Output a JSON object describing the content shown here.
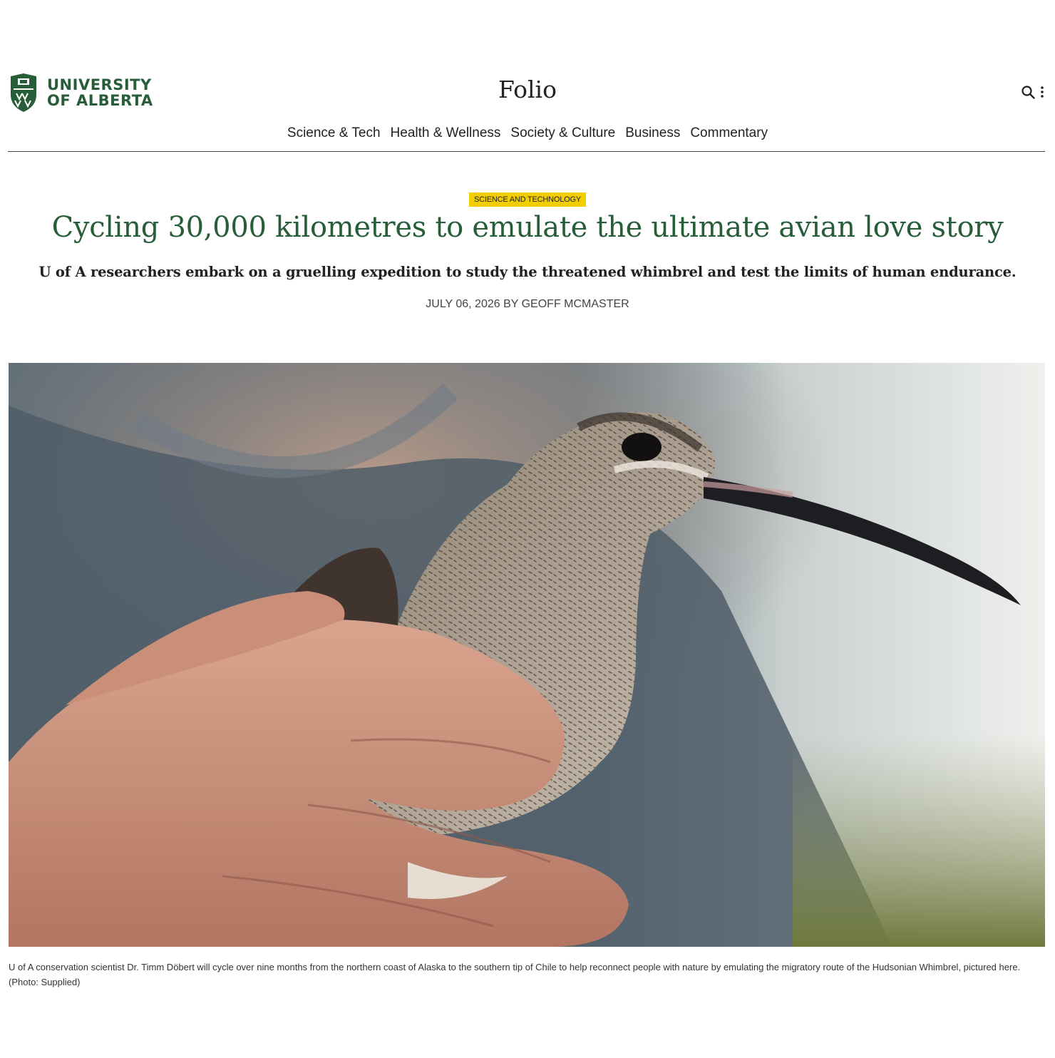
{
  "header": {
    "logo": {
      "line1": "UNIVERSITY",
      "line2": "OF ALBERTA"
    },
    "site_title": "Folio",
    "icons": [
      "search-icon",
      "more-vertical-icon"
    ]
  },
  "nav": {
    "items": [
      "Science & Tech",
      "Health & Wellness",
      "Society & Culture",
      "Business",
      "Commentary"
    ]
  },
  "article": {
    "category": "SCIENCE AND TECHNOLOGY",
    "title": "Cycling 30,000 kilometres to emulate the ultimate avian love story",
    "subtitle": "U of A researchers embark on a gruelling expedition to study the threatened whimbrel and test the limits of human endurance.",
    "date": "JULY 06, 2026",
    "by": "BY",
    "author": "GEOFF MCMASTER",
    "image_caption": "U of A conservation scientist Dr. Timm Döbert will cycle over nine months from the northern coast of Alaska to the southern tip of Chile to help reconnect people with nature by emulating the migratory route of the Hudsonian Whimbrel, pictured here. (Photo: Supplied)"
  },
  "colors": {
    "brand_green": "#275d38",
    "badge_yellow": "#f2cd00",
    "text": "#222222"
  }
}
